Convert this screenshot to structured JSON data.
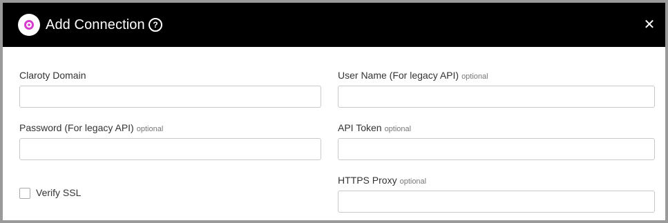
{
  "dialog": {
    "title": "Add Connection",
    "logo_icon": "claroty-logo-icon",
    "help_icon": "?",
    "close_icon": "✕"
  },
  "fields": {
    "claroty_domain": {
      "label": "Claroty Domain",
      "optional": "",
      "value": ""
    },
    "user_name": {
      "label": "User Name (For legacy API)",
      "optional": "optional",
      "value": ""
    },
    "password": {
      "label": "Password (For legacy API)",
      "optional": "optional",
      "value": ""
    },
    "api_token": {
      "label": "API Token",
      "optional": "optional",
      "value": ""
    },
    "https_proxy": {
      "label": "HTTPS Proxy",
      "optional": "optional",
      "value": ""
    }
  },
  "verify_ssl": {
    "label": "Verify SSL",
    "checked": false
  },
  "colors": {
    "header_bg": "#000000",
    "logo_accent": "#d63ccd"
  }
}
